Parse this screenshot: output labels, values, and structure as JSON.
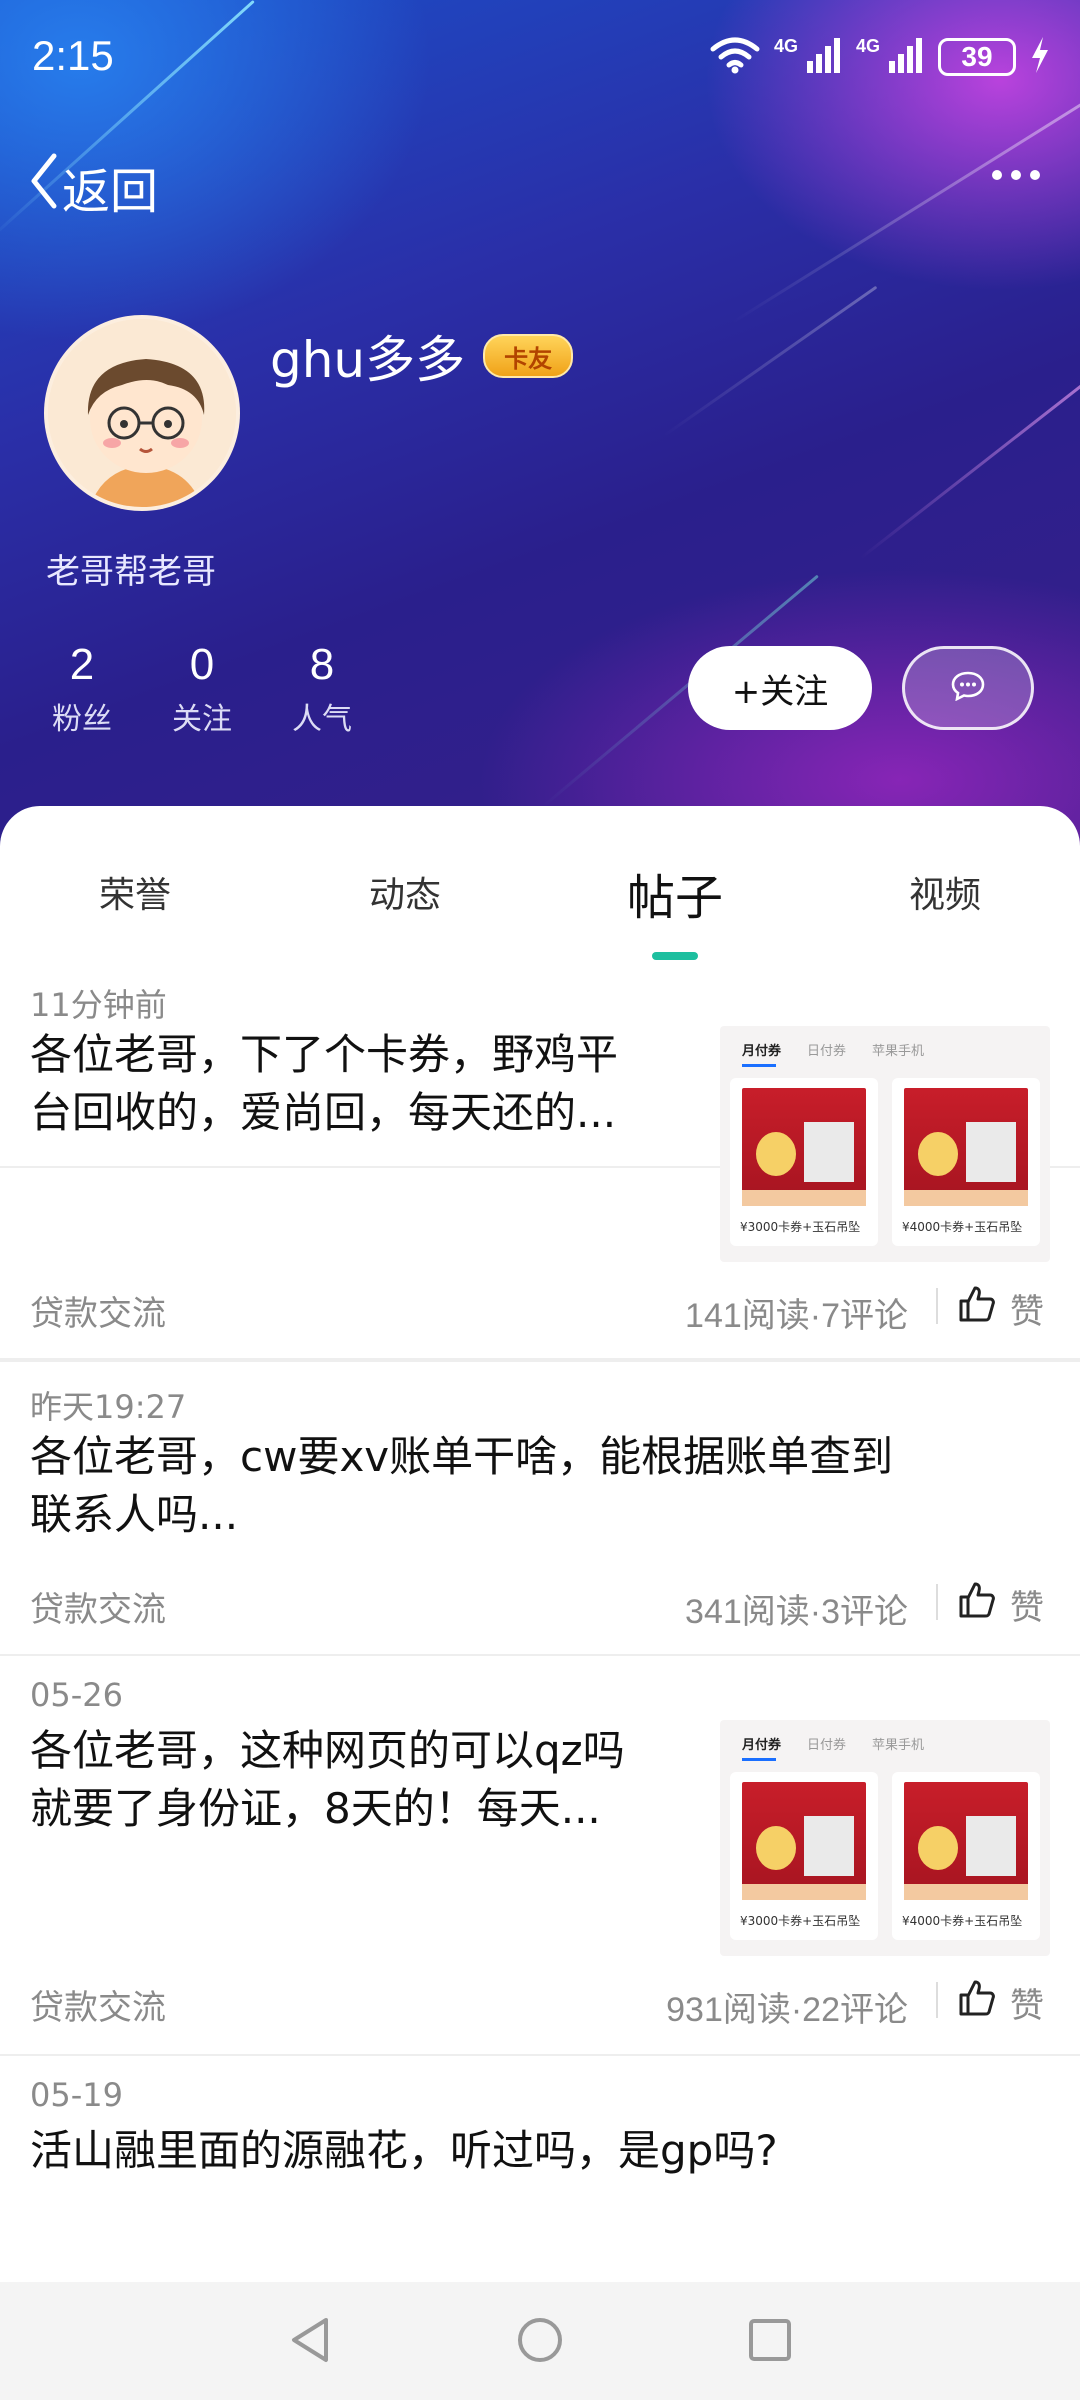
{
  "status_bar": {
    "time": "2:15",
    "network_1": "4G",
    "network_2": "4G",
    "battery": "39"
  },
  "topbar": {
    "back_label": "返回"
  },
  "profile": {
    "username": "ghu多多",
    "badge": "卡友",
    "signature": "老哥帮老哥",
    "stats": [
      {
        "value": "2",
        "label": "粉丝"
      },
      {
        "value": "0",
        "label": "关注"
      },
      {
        "value": "8",
        "label": "人气"
      }
    ],
    "follow_label": "+关注"
  },
  "tabs": [
    {
      "label": "荣誉",
      "active": false
    },
    {
      "label": "动态",
      "active": false
    },
    {
      "label": "帖子",
      "active": true
    },
    {
      "label": "视频",
      "active": false
    }
  ],
  "thumbnail": {
    "tabs": [
      "月付券",
      "日付券",
      "苹果手机"
    ],
    "captions": [
      "¥3000卡券+玉石吊坠",
      "¥4000卡券+玉石吊坠"
    ]
  },
  "posts": [
    {
      "time": "11分钟前",
      "title_lines": [
        "各位老哥，下了个卡券，野鸡平",
        "台回收的，爱尚回，每天还的..."
      ],
      "category": "贷款交流",
      "meta": "141阅读·7评论",
      "like_label": "赞",
      "has_thumbnail": true
    },
    {
      "time": "昨天19:27",
      "title_lines": [
        "各位老哥，cw要xv账单干啥，能根据账单查到",
        "联系人吗..."
      ],
      "category": "贷款交流",
      "meta": "341阅读·3评论",
      "like_label": "赞",
      "has_thumbnail": false
    },
    {
      "time": "05-26",
      "title_lines": [
        "各位老哥，这种网页的可以qz吗",
        "就要了身份证，8天的！每天..."
      ],
      "category": "贷款交流",
      "meta": "931阅读·22评论",
      "like_label": "赞",
      "has_thumbnail": true
    },
    {
      "time": "05-19",
      "title_lines": [
        "活山融里面的源融花，听过吗，是gp吗?"
      ],
      "category": "",
      "meta": "",
      "like_label": "",
      "has_thumbnail": false
    }
  ],
  "colors": {
    "accent": "#1dbf9f",
    "hero_top": "#1b4fc9",
    "hero_bottom": "#3a1f8a"
  }
}
